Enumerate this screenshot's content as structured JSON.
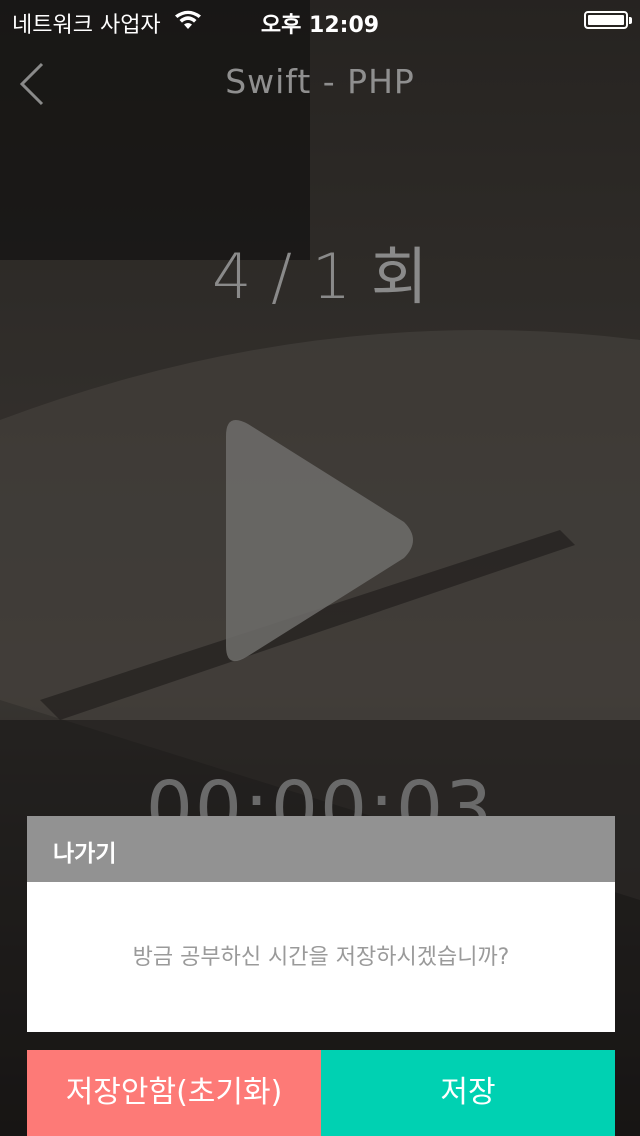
{
  "status_bar": {
    "carrier": "네트워크 사업자",
    "time": "오후 12:09"
  },
  "nav": {
    "title": "Swift - PHP",
    "back_icon": "chevron-left-icon"
  },
  "session": {
    "count_label": "4 / 1 회",
    "timer": "00:00:03",
    "play_icon": "play-icon"
  },
  "dialog": {
    "title": "나가기",
    "message": "방금 공부하신 시간을 저장하시겠습니까?",
    "dont_save_label": "저장안함(초기화)",
    "save_label": "저장"
  },
  "colors": {
    "dont_save_button": "#fd7a77",
    "save_button": "#00d1b2",
    "dialog_header": "#929292"
  }
}
